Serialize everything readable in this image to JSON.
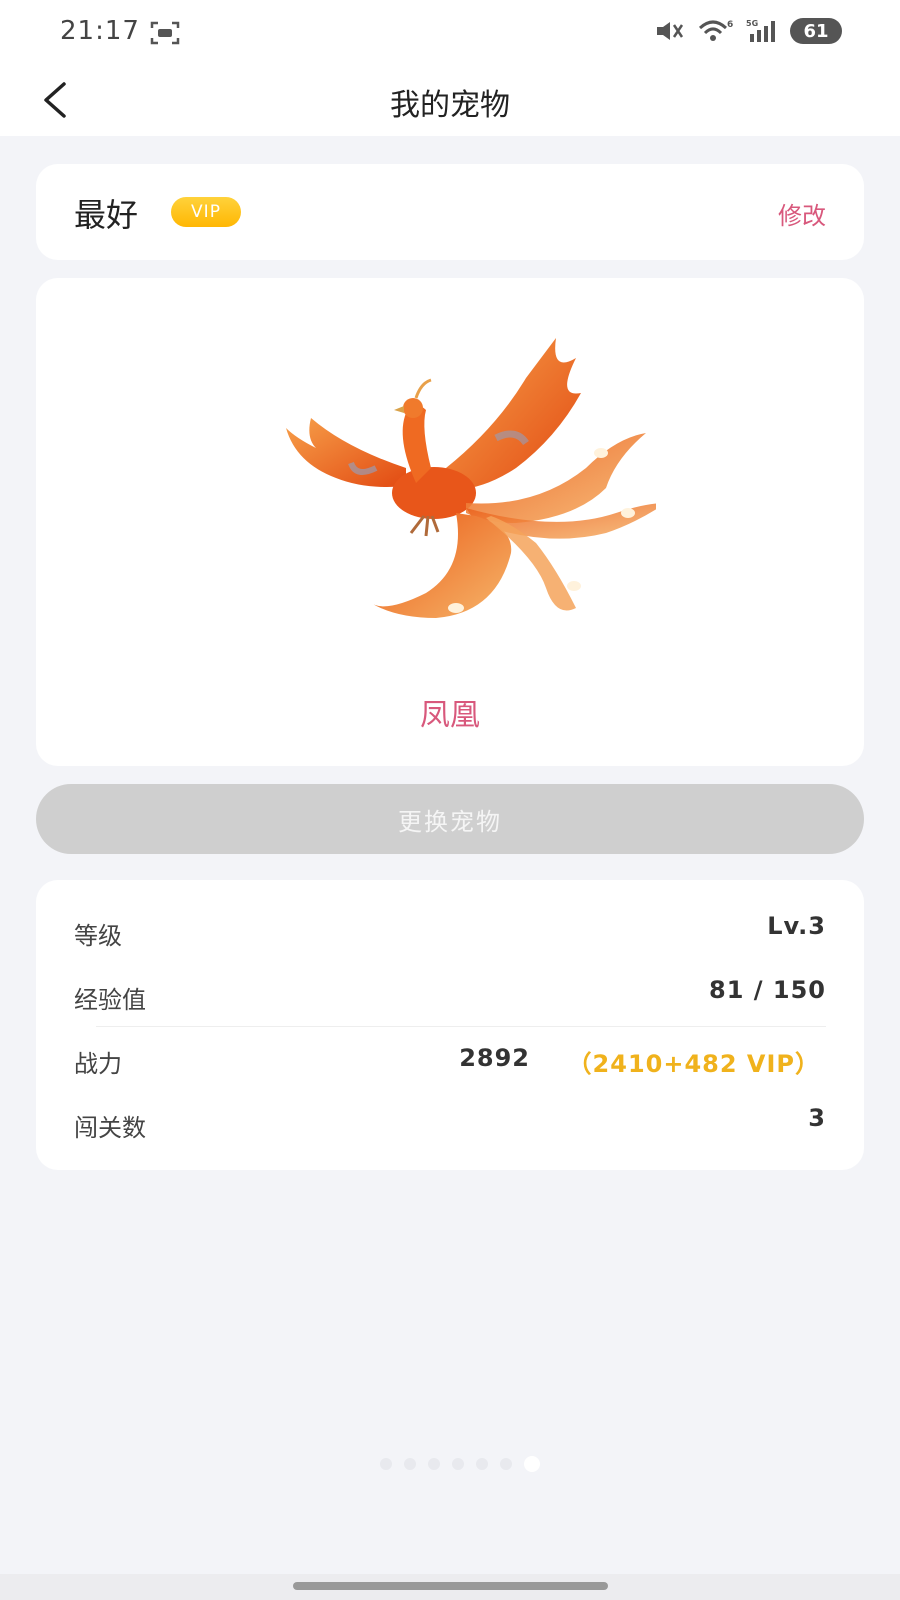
{
  "status_bar": {
    "time": "21:17",
    "network_small": "6",
    "network_type": "5G",
    "battery": "61",
    "icons": [
      "screen-record-icon",
      "mute-icon",
      "wifi-icon",
      "signal-icon",
      "battery-icon"
    ]
  },
  "header": {
    "title": "我的宠物"
  },
  "pet_card": {
    "name": "最好",
    "vip_label": "VIP",
    "edit_label": "修改"
  },
  "pet": {
    "species": "凤凰"
  },
  "actions": {
    "change_pet": "更换宠物"
  },
  "stats": {
    "level_label": "等级",
    "level_value": "Lv.3",
    "exp_label": "经验值",
    "exp_value": "81 / 150",
    "power_label": "战力",
    "power_value": "2892",
    "power_bonus": "（2410+482 VIP）",
    "stages_label": "闯关数",
    "stages_value": "3"
  },
  "colors": {
    "accent_pink": "#d8587c",
    "vip_gold": "#ffb703",
    "bonus_gold": "#f0b21c",
    "disabled_button": "#cfcfcf",
    "page_bg": "#f3f4f8"
  }
}
